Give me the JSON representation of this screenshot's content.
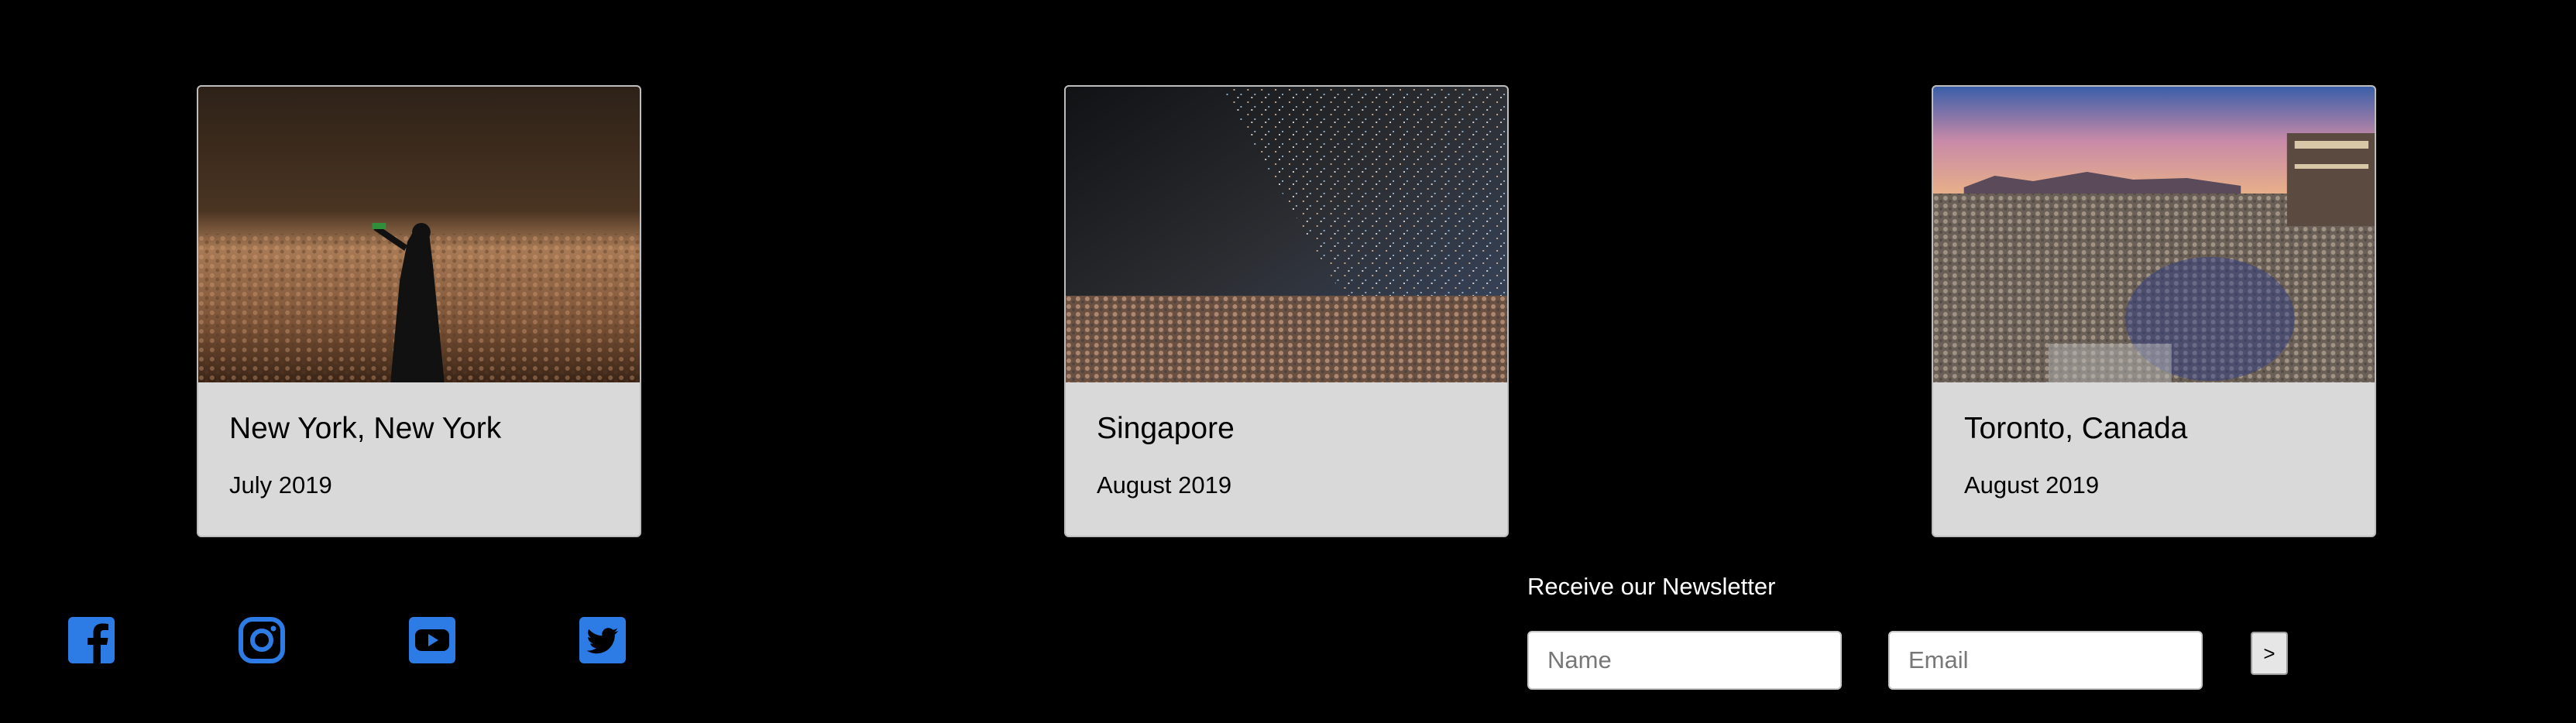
{
  "cards": [
    {
      "title": "New York, New York",
      "date": "July 2019",
      "image": "concert-crowd-performer-photo"
    },
    {
      "title": "Singapore",
      "date": "August 2019",
      "image": "concert-crowd-confetti-photo"
    },
    {
      "title": "Toronto, Canada",
      "date": "August 2019",
      "image": "outdoor-festival-crowd-sunset-photo"
    }
  ],
  "social": {
    "icons": [
      "facebook-icon",
      "instagram-icon",
      "youtube-icon",
      "twitter-icon"
    ],
    "color": "#2d7be5"
  },
  "newsletter": {
    "title": "Receive our Newsletter",
    "name_placeholder": "Name",
    "email_placeholder": "Email",
    "submit_label": ">"
  }
}
